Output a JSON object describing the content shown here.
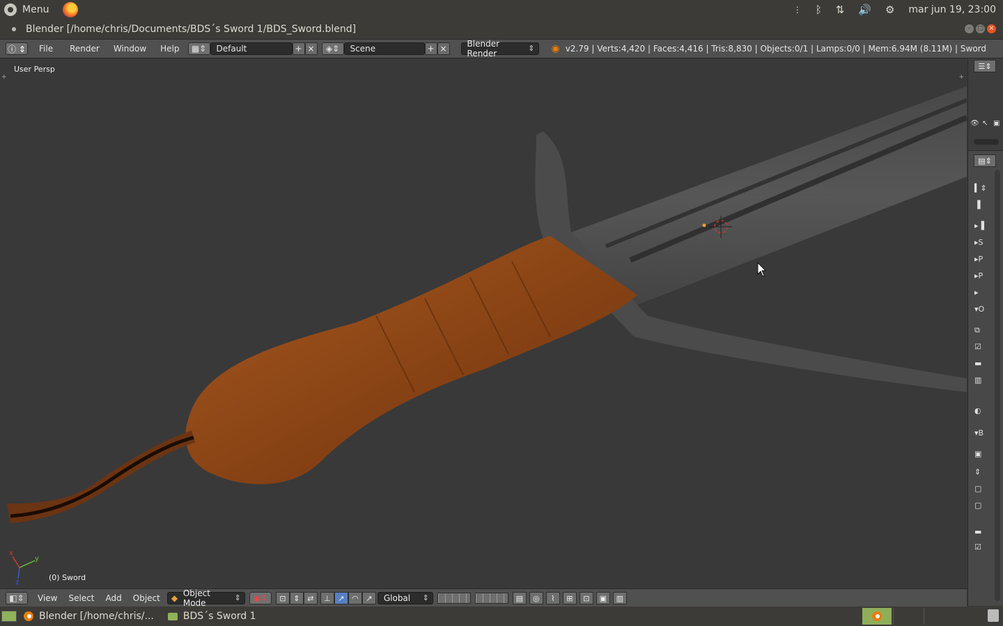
{
  "top_panel": {
    "menu_label": "Menu",
    "datetime": "mar jun 19, 23:00"
  },
  "window": {
    "title": "Blender [/home/chris/Documents/BDS´s Sword 1/BDS_Sword.blend]"
  },
  "info_header": {
    "menus": [
      "File",
      "Render",
      "Window",
      "Help"
    ],
    "screen_layout": "Default",
    "scene": "Scene",
    "render_engine": "Blender Render",
    "stats": "v2.79 | Verts:4,420 | Faces:4,416 | Tris:8,830 | Objects:0/1 | Lamps:0/0 | Mem:6.94M (8.11M) | Sword"
  },
  "viewport": {
    "view_name": "User Persp",
    "active_object": "(0) Sword",
    "axis_labels": {
      "x": "x",
      "y": "y",
      "z": "z"
    }
  },
  "view_header": {
    "menus": [
      "View",
      "Select",
      "Add",
      "Object"
    ],
    "mode": "Object Mode",
    "transform_orientation": "Global"
  },
  "properties_panel": {
    "row_labels": [
      "S",
      "P",
      "P",
      "O",
      "B"
    ]
  },
  "taskbar": {
    "items": [
      "Blender [/home/chris/...",
      "BDS´s Sword 1"
    ]
  },
  "colors": {
    "accent": "#e95420",
    "blender_orange": "#e87d0d",
    "active_blue": "#5680c2",
    "wood": "#9a4a18"
  }
}
